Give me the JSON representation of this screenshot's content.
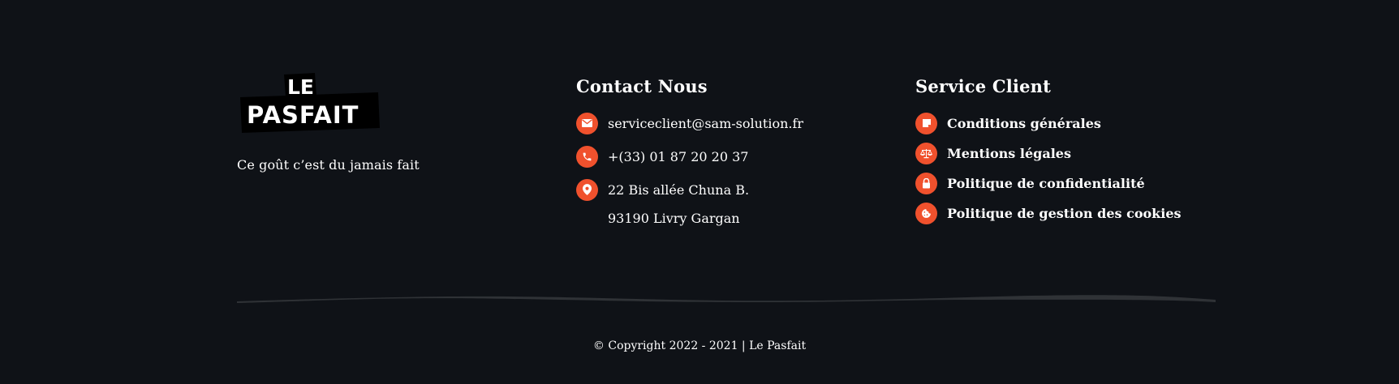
{
  "brand": {
    "logo_text_line1": "LE",
    "logo_text_line2": "PASFAIT",
    "tagline": "Ce goût c’est du jamais fait"
  },
  "contact": {
    "title": "Contact Nous",
    "email": "serviceclient@sam-solution.fr",
    "phone": "+(33) 01 87 20 20 37",
    "address_line1": "22 Bis allée Chuna B.",
    "address_line2": "93190 Livry Gargan",
    "icons": [
      "envelope-icon",
      "phone-icon",
      "map-pin-icon"
    ]
  },
  "service": {
    "title": "Service Client",
    "items": [
      {
        "label": "Conditions générales",
        "icon": "note-icon"
      },
      {
        "label": "Mentions légales",
        "icon": "scale-icon"
      },
      {
        "label": "Politique de confidentialité",
        "icon": "lock-icon"
      },
      {
        "label": "Politique de gestion des cookies",
        "icon": "cookie-icon"
      }
    ]
  },
  "footer": {
    "copyright": "© Copyright 2022 - 2021 | Le Pasfait"
  },
  "colors": {
    "background": "#0f1217",
    "accent": "#f0512d",
    "text": "#ffffff",
    "divider": "#2f3236"
  }
}
